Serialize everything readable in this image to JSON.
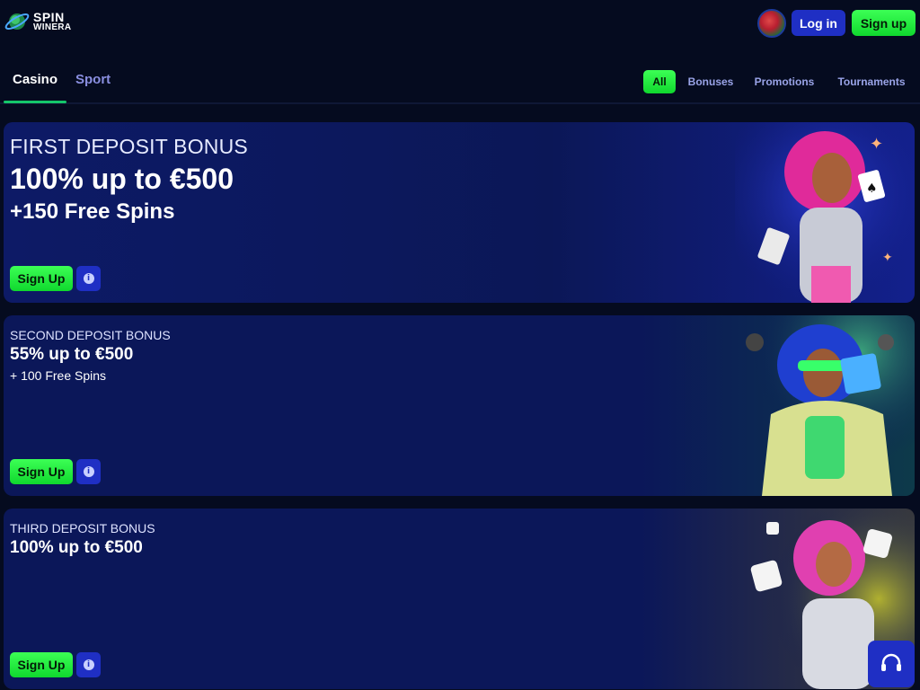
{
  "header": {
    "logo_line1": "SPIN",
    "logo_line2": "WINERA",
    "login_label": "Log in",
    "signup_label": "Sign up"
  },
  "tabs": {
    "casino": "Casino",
    "sport": "Sport"
  },
  "filters": {
    "all": "All",
    "bonuses": "Bonuses",
    "promotions": "Promotions",
    "tournaments": "Tournaments"
  },
  "cards": [
    {
      "title": "FIRST DEPOSIT BONUS",
      "amount": "100% up to €500",
      "extra": "+150 Free Spins",
      "signup_label": "Sign Up",
      "info_icon": "i"
    },
    {
      "title": "SECOND DEPOSIT BONUS",
      "amount": "55% up to €500",
      "extra": "+ 100 Free Spins",
      "signup_label": "Sign Up",
      "info_icon": "i"
    },
    {
      "title": "THIRD DEPOSIT BONUS",
      "amount": "100% up to €500",
      "signup_label": "Sign Up",
      "info_icon": "i"
    }
  ],
  "colors": {
    "accent_green": "#10d82e",
    "accent_blue": "#1f2fc4",
    "background": "#050b1f",
    "card_background": "#0b1759"
  },
  "icons": {
    "logo": "planet-logo-icon",
    "language": "flag-icon",
    "info": "info-icon",
    "support": "headset-icon"
  }
}
